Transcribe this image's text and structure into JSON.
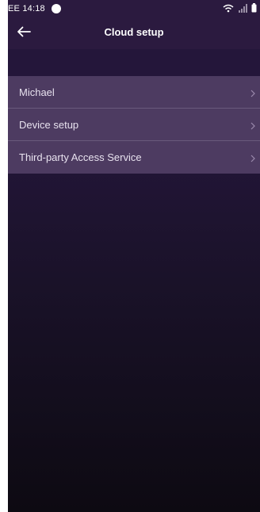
{
  "status_bar": {
    "carrier_time": "EE 14:18"
  },
  "app_bar": {
    "title": "Cloud setup"
  },
  "menu": {
    "items": [
      {
        "label": "Michael"
      },
      {
        "label": "Device setup"
      },
      {
        "label": "Third-party Access Service"
      }
    ]
  },
  "icons": {
    "back": "arrow-left-icon",
    "chevron": "chevron-right-icon",
    "wifi": "wifi-icon",
    "signal": "signal-icon",
    "battery": "battery-icon",
    "dot": "record-dot-icon"
  },
  "colors": {
    "app_bar": "#2b1a3f",
    "menu_item": "#4d3b61",
    "text": "#ffffff"
  }
}
